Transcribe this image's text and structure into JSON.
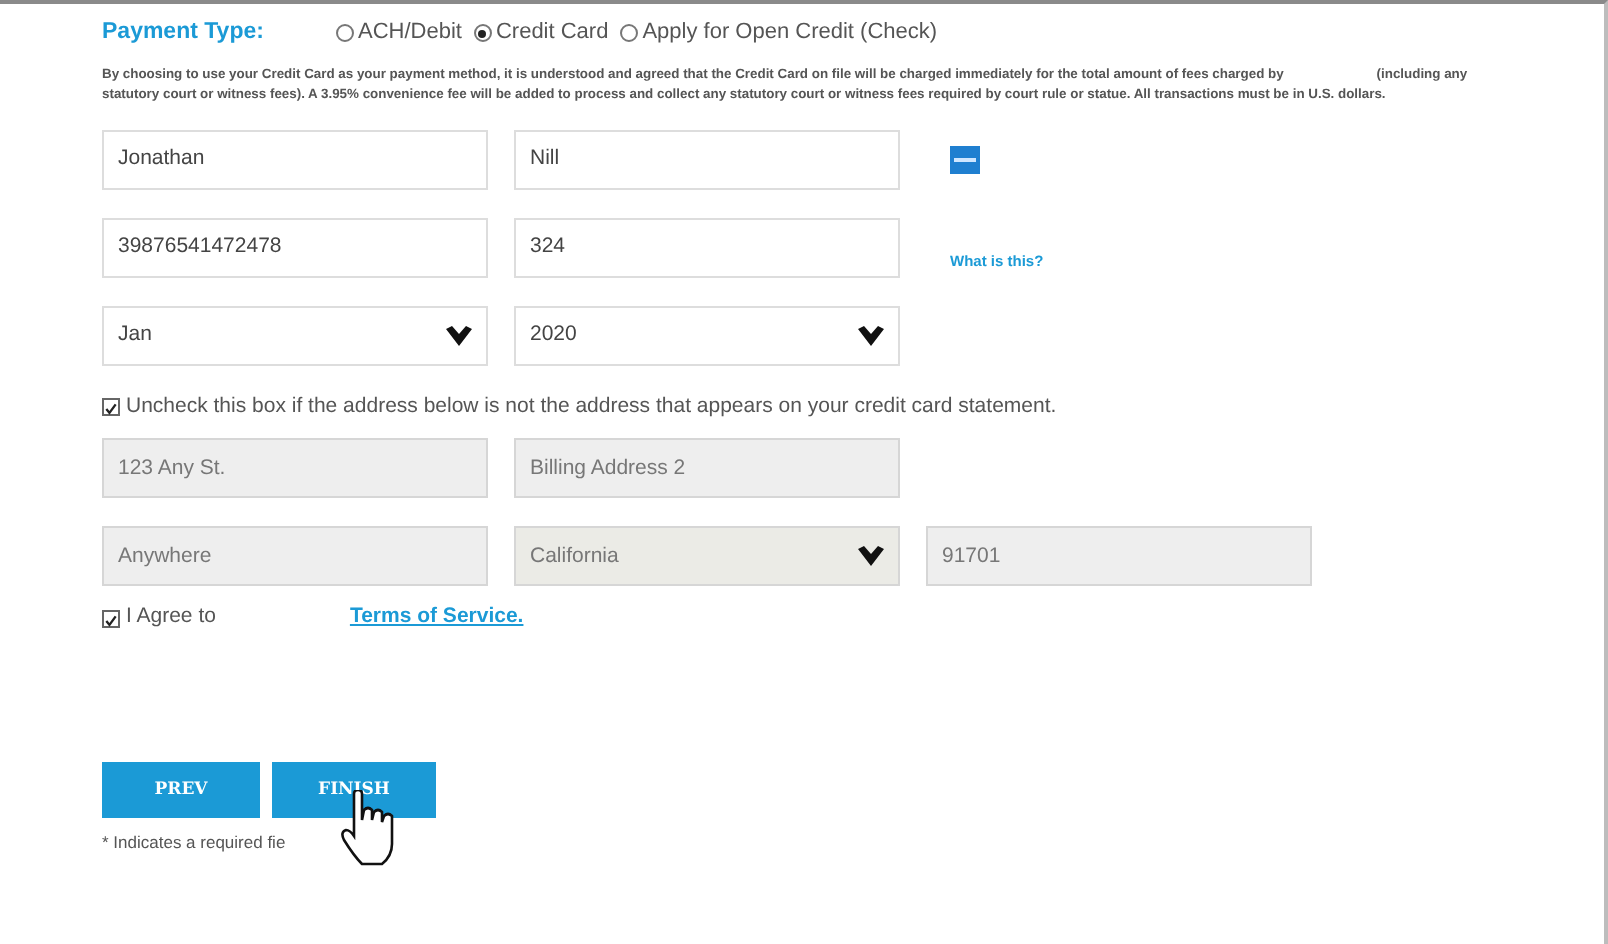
{
  "payment_type": {
    "label": "Payment Type:",
    "options": [
      {
        "label": "ACH/Debit",
        "selected": false
      },
      {
        "label": "Credit Card",
        "selected": true
      },
      {
        "label": "Apply for Open Credit (Check)",
        "selected": false
      }
    ]
  },
  "notice": "By choosing to use your Credit Card as your payment method, it is understood and agreed that the Credit Card on file will be charged immediately for the total amount of fees charged by                         (including any statutory court or witness fees). A 3.95% convenience fee will be added to process and collect any statutory court or witness fees required by court rule or statue. All transactions must be in U.S. dollars.",
  "card_rows": [
    [
      {
        "kind": "input",
        "value": "Jonathan",
        "disabled": false
      },
      {
        "kind": "input",
        "value": "Nill",
        "disabled": false
      },
      {
        "kind": "card-logo"
      }
    ],
    [
      {
        "kind": "input",
        "value": "39876541472478",
        "disabled": false
      },
      {
        "kind": "input",
        "value": "324",
        "disabled": false
      },
      {
        "kind": "link",
        "text": "What is this?"
      }
    ],
    [
      {
        "kind": "select",
        "value": "Jan",
        "disabled": false
      },
      {
        "kind": "select",
        "value": "2020",
        "disabled": false
      }
    ]
  ],
  "same_address": {
    "label": "Uncheck this box if the address below is not the address that appears on your credit card statement.",
    "checked": true
  },
  "address_rows": [
    [
      {
        "kind": "input",
        "value": "123 Any St.",
        "disabled": true
      },
      {
        "kind": "input",
        "value": "Billing Address 2",
        "disabled": true
      }
    ],
    [
      {
        "kind": "input",
        "value": "Anywhere",
        "disabled": true
      },
      {
        "kind": "select",
        "value": "California",
        "disabled": true
      },
      {
        "kind": "input",
        "value": "91701",
        "disabled": true
      }
    ]
  ],
  "agree": {
    "label": "I Agree to",
    "link": "Terms of Service.",
    "checked": true
  },
  "buttons": [
    {
      "label": "PREV"
    },
    {
      "label": "FINISH"
    }
  ],
  "required_note": "* Indicates a required fie"
}
